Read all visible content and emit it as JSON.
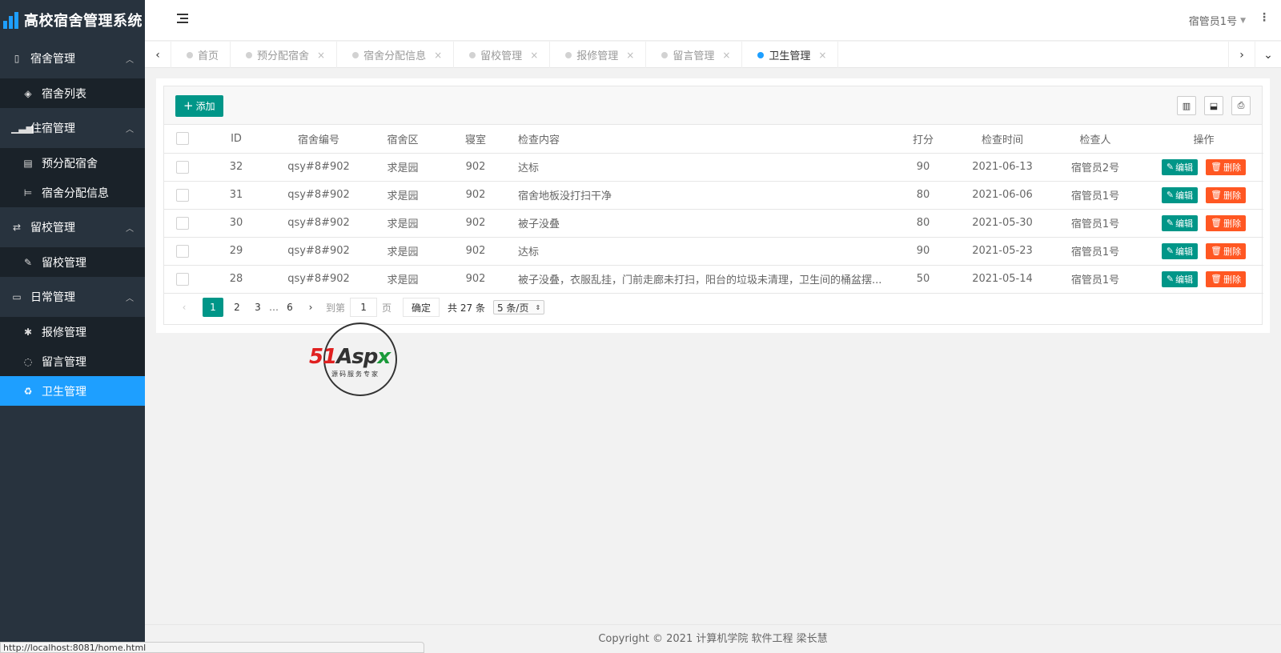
{
  "app": {
    "title": "高校宿舍管理系统"
  },
  "colors": {
    "accent": "#1e9fff",
    "primary": "#009688",
    "danger": "#ff5722",
    "sidebar_bg": "#28333e"
  },
  "sidebar": {
    "groups": [
      {
        "label": "宿舍管理",
        "icon": "building-icon",
        "items": [
          {
            "label": "宿舍列表",
            "icon": "cube-icon"
          }
        ]
      },
      {
        "label": "住宿管理",
        "icon": "signal-icon",
        "items": [
          {
            "label": "预分配宿舍",
            "icon": "id-card-icon"
          },
          {
            "label": "宿舍分配信息",
            "icon": "bed-icon"
          }
        ]
      },
      {
        "label": "留校管理",
        "icon": "exchange-icon",
        "items": [
          {
            "label": "留校管理",
            "icon": "edit-icon"
          }
        ]
      },
      {
        "label": "日常管理",
        "icon": "laptop-icon",
        "items": [
          {
            "label": "报修管理",
            "icon": "gear-icon"
          },
          {
            "label": "留言管理",
            "icon": "comment-icon"
          },
          {
            "label": "卫生管理",
            "icon": "recycle-icon"
          }
        ]
      }
    ]
  },
  "header": {
    "user": "宿管员1号"
  },
  "tabs": [
    {
      "label": "首页",
      "closable": false
    },
    {
      "label": "预分配宿舍",
      "closable": true
    },
    {
      "label": "宿舍分配信息",
      "closable": true
    },
    {
      "label": "留校管理",
      "closable": true
    },
    {
      "label": "报修管理",
      "closable": true
    },
    {
      "label": "留言管理",
      "closable": true
    },
    {
      "label": "卫生管理",
      "closable": true,
      "active": true
    }
  ],
  "toolbar": {
    "add_label": "添加"
  },
  "table": {
    "columns": [
      "ID",
      "宿舍编号",
      "宿舍区",
      "寝室",
      "检查内容",
      "打分",
      "检查时间",
      "检查人",
      "操作"
    ],
    "edit_label": "编辑",
    "delete_label": "删除",
    "rows": [
      {
        "id": "32",
        "dorm_no": "qsy#8#902",
        "area": "求是园",
        "room": "902",
        "content": "达标",
        "score": "90",
        "date": "2021-06-13",
        "inspector": "宿管员2号"
      },
      {
        "id": "31",
        "dorm_no": "qsy#8#902",
        "area": "求是园",
        "room": "902",
        "content": "宿舍地板没打扫干净",
        "score": "80",
        "date": "2021-06-06",
        "inspector": "宿管员1号"
      },
      {
        "id": "30",
        "dorm_no": "qsy#8#902",
        "area": "求是园",
        "room": "902",
        "content": "被子没叠",
        "score": "80",
        "date": "2021-05-30",
        "inspector": "宿管员1号"
      },
      {
        "id": "29",
        "dorm_no": "qsy#8#902",
        "area": "求是园",
        "room": "902",
        "content": "达标",
        "score": "90",
        "date": "2021-05-23",
        "inspector": "宿管员1号"
      },
      {
        "id": "28",
        "dorm_no": "qsy#8#902",
        "area": "求是园",
        "room": "902",
        "content": "被子没叠，衣服乱挂，门前走廊未打扫，阳台的垃圾未清理，卫生间的桶盆摆...",
        "score": "50",
        "date": "2021-05-14",
        "inspector": "宿管员1号"
      }
    ]
  },
  "pager": {
    "pages": [
      "1",
      "2",
      "3",
      "…",
      "6"
    ],
    "current": "1",
    "goto_label": "到第",
    "goto_value": "1",
    "page_unit": "页",
    "confirm_label": "确定",
    "total_label": "共 27 条",
    "limit_label": "5 条/页"
  },
  "watermark": {
    "brand_red": "51",
    "brand_dark": "Asp",
    "brand_green": "x",
    "subtitle": "源码服务专家"
  },
  "footer": {
    "copyright": "Copyright © 2021 计算机学院 软件工程 梁长慧"
  },
  "status_bar": {
    "url": "http://localhost:8081/home.html"
  }
}
